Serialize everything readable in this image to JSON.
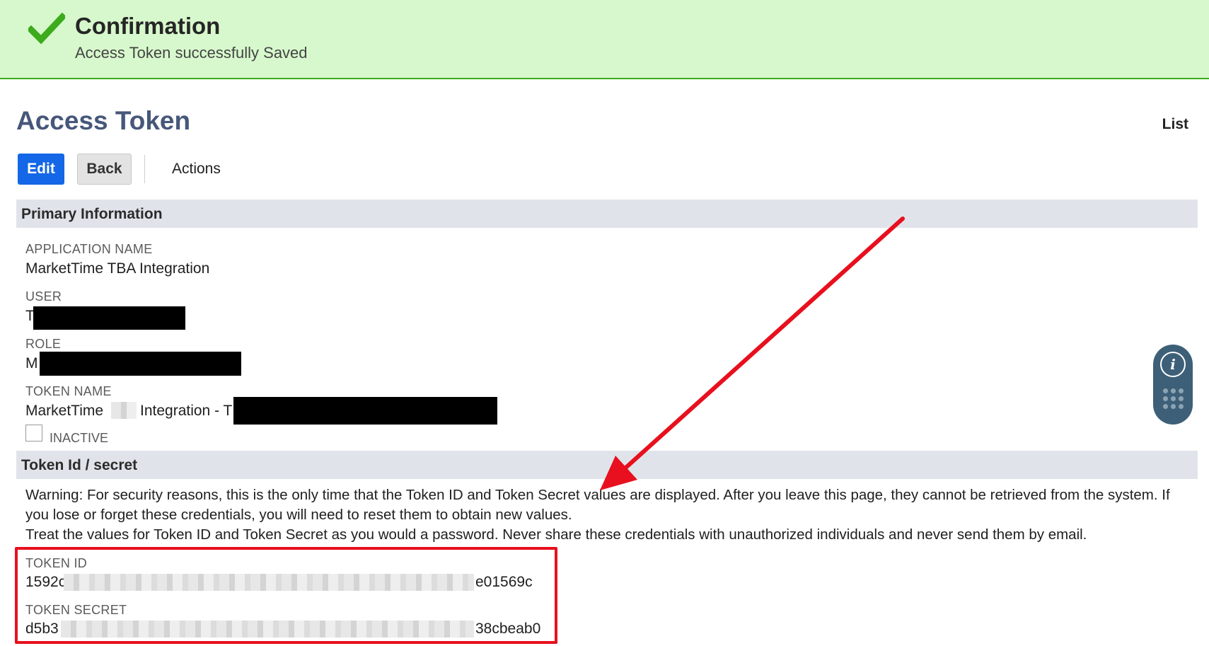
{
  "banner": {
    "title": "Confirmation",
    "message": "Access Token successfully Saved",
    "icon": "check-icon"
  },
  "header": {
    "title": "Access Token",
    "list_link": "List"
  },
  "toolbar": {
    "edit_label": "Edit",
    "back_label": "Back",
    "actions_label": "Actions"
  },
  "primary": {
    "section_title": "Primary Information",
    "application_name_label": "APPLICATION NAME",
    "application_name_value": "MarketTime TBA Integration",
    "user_label": "USER",
    "user_value": "T",
    "role_label": "ROLE",
    "role_value": "M",
    "token_name_label": "TOKEN NAME",
    "token_name_value_a": "MarketTime",
    "token_name_value_b": "Integration - T",
    "inactive_label": "INACTIVE",
    "inactive_checked": false
  },
  "token": {
    "section_title": "Token Id / secret",
    "warning_line1": "Warning: For security reasons, this is the only time that the Token ID and Token Secret values are displayed. After you leave this page, they cannot be retrieved from the system. If you lose or forget these credentials, you will need to reset them to obtain new values.",
    "warning_line2": "Treat the values for Token ID and Token Secret as you would a password. Never share these credentials with unauthorized individuals and never send them by email.",
    "token_id_label": "TOKEN ID",
    "token_id_prefix": "1592c",
    "token_id_suffix": "e01569c",
    "token_secret_label": "TOKEN SECRET",
    "token_secret_prefix": "d5b3",
    "token_secret_suffix": "38cbeab0"
  },
  "widget": {
    "info_icon": "info-icon",
    "dots_icon": "grid-dots-icon"
  },
  "colors": {
    "banner_bg": "#d7f8cc",
    "accent": "#1467e6",
    "title": "#46577a",
    "annotation": "#e8101e"
  }
}
